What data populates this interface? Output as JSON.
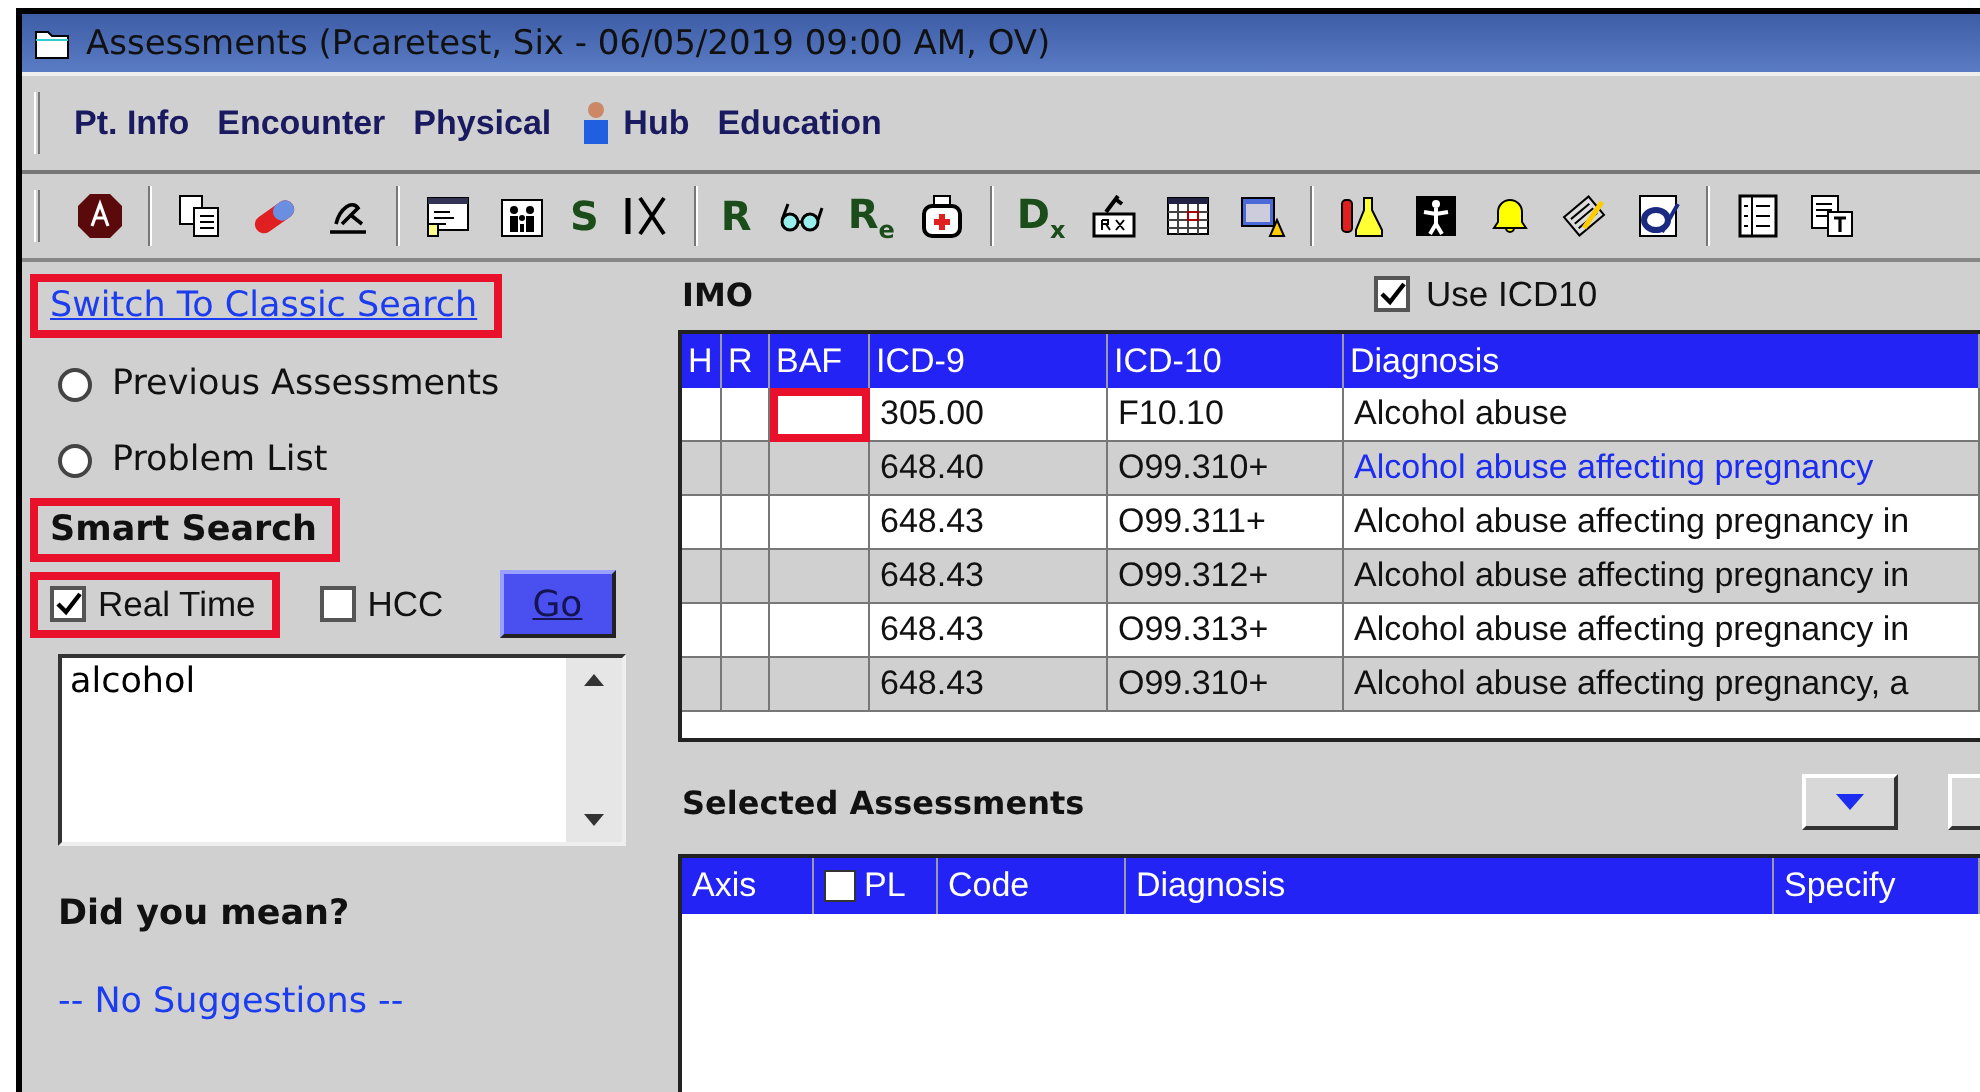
{
  "window": {
    "title": "Assessments (Pcaretest, Six - 06/05/2019  09:00 AM, OV)"
  },
  "menu": [
    {
      "label": "Pt. Info",
      "kind": "text"
    },
    {
      "label": "Encounter",
      "kind": "text"
    },
    {
      "label": "Physical",
      "kind": "text"
    },
    {
      "label": "Hub",
      "kind": "icon-text"
    },
    {
      "label": "Education",
      "kind": "text"
    }
  ],
  "toolbar": [
    {
      "kind": "icon"
    },
    {
      "kind": "separator"
    },
    {
      "kind": "icon"
    },
    {
      "kind": "icon"
    },
    {
      "kind": "icon"
    },
    {
      "kind": "separator"
    },
    {
      "kind": "icon"
    },
    {
      "kind": "icon"
    },
    {
      "kind": "letter",
      "text": "S"
    },
    {
      "kind": "icon"
    },
    {
      "kind": "separator"
    },
    {
      "kind": "letter",
      "text": "R"
    },
    {
      "kind": "icon"
    },
    {
      "kind": "letter",
      "text": "R$_{e}$"
    },
    {
      "kind": "icon"
    },
    {
      "kind": "separator"
    },
    {
      "kind": "letter",
      "text": "D$_{x}$"
    },
    {
      "kind": "icon"
    },
    {
      "kind": "icon"
    },
    {
      "kind": "icon"
    },
    {
      "kind": "separator"
    },
    {
      "kind": "icon"
    },
    {
      "kind": "icon"
    },
    {
      "kind": "icon"
    },
    {
      "kind": "icon"
    },
    {
      "kind": "icon"
    },
    {
      "kind": "separator"
    },
    {
      "kind": "icon"
    },
    {
      "kind": "icon"
    }
  ],
  "sidebar": {
    "classic_link": {
      "label": "Switch To Classic Search",
      "highlighted": true
    },
    "options": [
      {
        "label": "Previous Assessments",
        "selected": false
      },
      {
        "label": "Problem List",
        "selected": false
      }
    ],
    "smart_search": {
      "label": "Smart Search",
      "highlighted": true
    },
    "checks": [
      {
        "label": "Real Time",
        "checked": true,
        "highlighted": true
      },
      {
        "label": "HCC",
        "checked": false,
        "highlighted": false
      }
    ],
    "go_button": "Go",
    "search_text": "alcohol",
    "did_you_mean": "Did you mean?",
    "suggestions": "-- No Suggestions --"
  },
  "imo": {
    "title": "IMO",
    "use_icd10": {
      "label": "Use ICD10",
      "checked": true
    },
    "columns": [
      "H",
      "R",
      "BAF",
      "ICD-9",
      "ICD-10",
      "Diagnosis"
    ],
    "rows": [
      {
        "icd9": "305.00",
        "icd10": "F10.10",
        "diagnosis": "Alcohol abuse",
        "selected": false,
        "highlighted": true
      },
      {
        "icd9": "648.40",
        "icd10": "O99.310+",
        "diagnosis": "Alcohol abuse affecting pregnancy",
        "selected": true,
        "highlighted": false
      },
      {
        "icd9": "648.43",
        "icd10": "O99.311+",
        "diagnosis": "Alcohol abuse affecting pregnancy in",
        "selected": false,
        "highlighted": false
      },
      {
        "icd9": "648.43",
        "icd10": "O99.312+",
        "diagnosis": "Alcohol abuse affecting pregnancy in",
        "selected": false,
        "highlighted": false
      },
      {
        "icd9": "648.43",
        "icd10": "O99.313+",
        "diagnosis": "Alcohol abuse affecting pregnancy in",
        "selected": false,
        "highlighted": false
      },
      {
        "icd9": "648.43",
        "icd10": "O99.310+",
        "diagnosis": "Alcohol abuse affecting pregnancy, a",
        "selected": false,
        "highlighted": false
      }
    ]
  },
  "selected_assessments": {
    "title": "Selected Assessments",
    "columns": [
      {
        "label": "Axis"
      },
      {
        "label": "PL",
        "checked": false
      },
      {
        "label": "Code"
      },
      {
        "label": "Diagnosis"
      },
      {
        "label": "Specify"
      }
    ]
  }
}
